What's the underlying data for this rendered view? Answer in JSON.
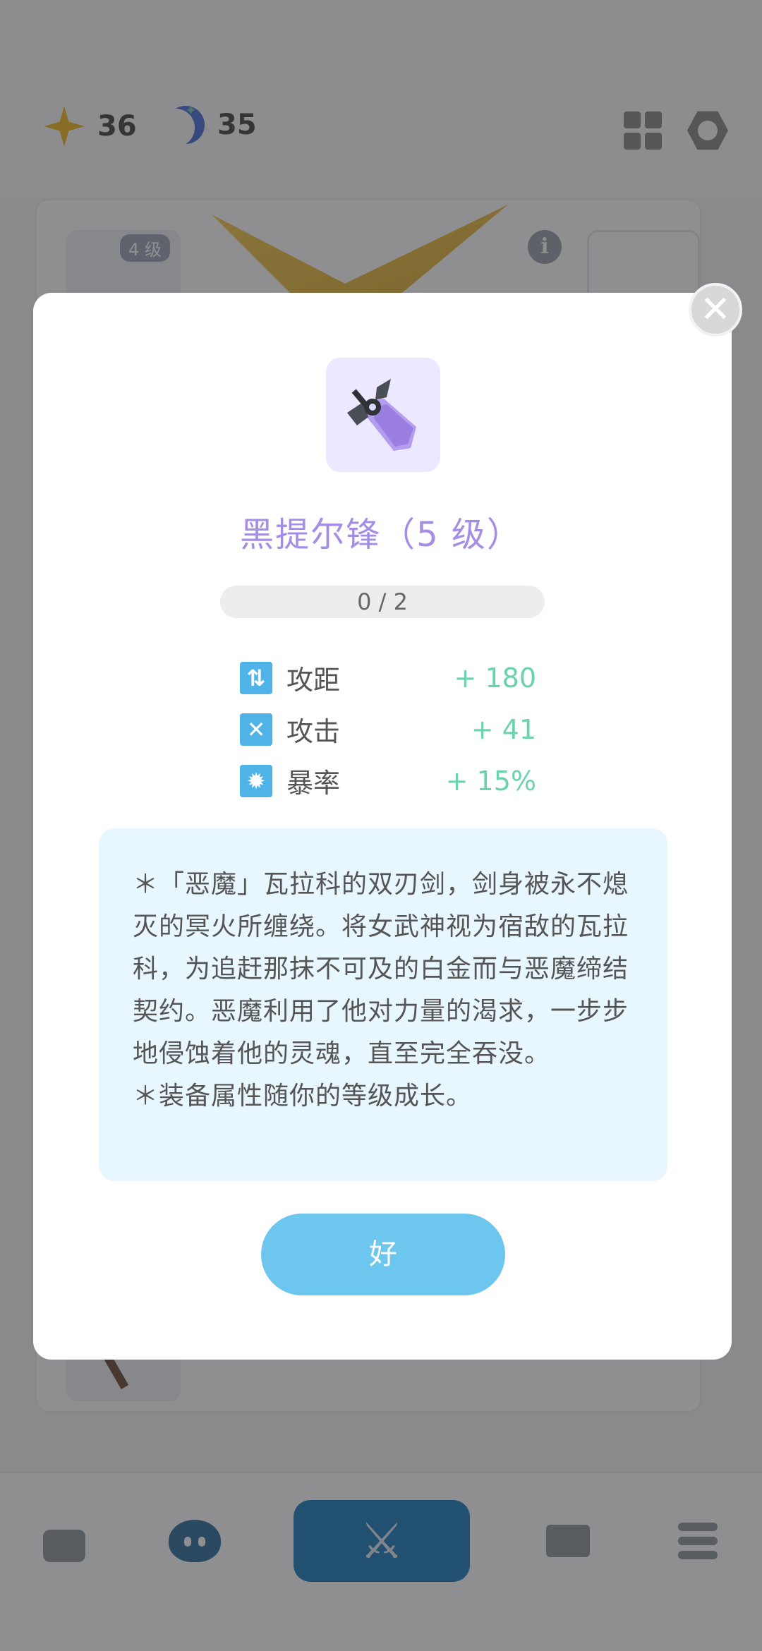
{
  "currencies": {
    "stars": {
      "value": "36",
      "icon": "star-icon",
      "color": "#f2b81e"
    },
    "moons": {
      "value": "35",
      "icon": "moon-icon",
      "color": "#4a6fd6"
    }
  },
  "background_card": {
    "level_badge": "4 级",
    "info_icon": "i"
  },
  "nav": {
    "items": [
      {
        "name": "bag",
        "icon": "bag-icon"
      },
      {
        "name": "character",
        "icon": "face-icon"
      },
      {
        "name": "battle",
        "icon": "swords-icon",
        "active": true
      },
      {
        "name": "mail",
        "icon": "mail-icon"
      },
      {
        "name": "menu",
        "icon": "menu-icon"
      }
    ],
    "battle_glyph": "⚔"
  },
  "modal": {
    "close_glyph": "✕",
    "title": "黑提尔锋（5 级）",
    "progress": "0 / 2",
    "progress_value": 0,
    "stats": [
      {
        "icon": "range-icon",
        "glyph": "⇅",
        "label": "攻距",
        "value": "+ 180"
      },
      {
        "icon": "attack-icon",
        "glyph": "✕",
        "label": "攻击",
        "value": "+ 41"
      },
      {
        "icon": "crit-icon",
        "glyph": "✹",
        "label": "暴率",
        "value": "+ 15%"
      }
    ],
    "description": "＊「恶魔」瓦拉科的双刃剑，剑身被永不熄灭的冥火所缠绕。将女武神视为宿敌的瓦拉科，为追赶那抹不可及的白金而与恶魔缔结契约。恶魔利用了他对力量的渴求，一步步地侵蚀着他的灵魂，直至完全吞没。",
    "note": "＊装备属性随你的等级成长。",
    "ok_label": "好"
  },
  "colors": {
    "title": "#a58de6",
    "stat_value": "#6ad2ae",
    "stat_icon": "#4fb3e8",
    "ok_button": "#6cc6ee",
    "desc_bg": "#e8f7fe"
  }
}
